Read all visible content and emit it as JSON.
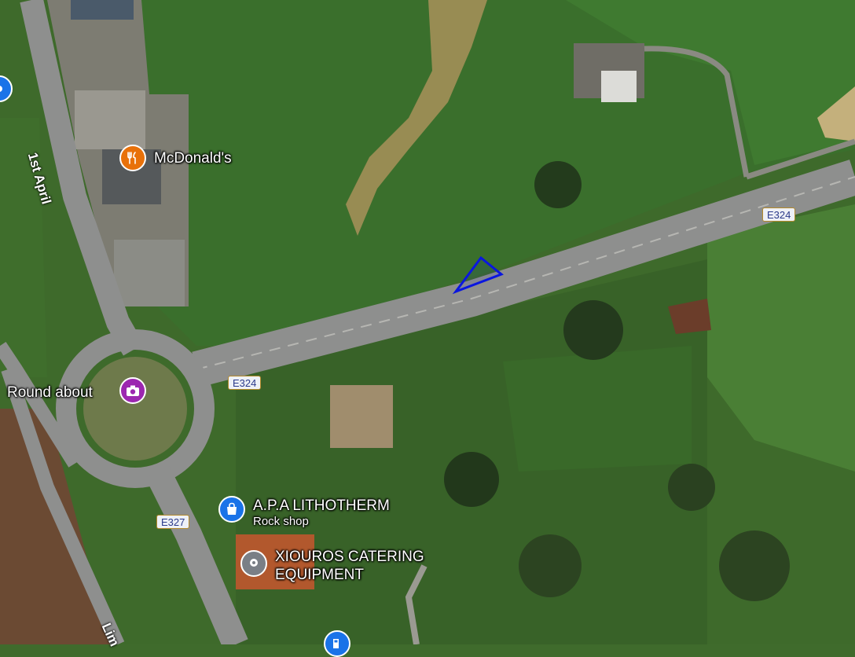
{
  "map": {
    "type": "satellite",
    "places": {
      "mcdonalds": {
        "name": "McDonald's",
        "icon": "restaurant-icon",
        "color": "#e8710a"
      },
      "roundabout": {
        "name": "Round about",
        "icon": "camera-icon",
        "color": "#9c27b0"
      },
      "lithotherm": {
        "name": "A.P.A LITHOTHERM",
        "subtitle": "Rock shop",
        "icon": "shopping-bag-icon",
        "color": "#1a73e8"
      },
      "xiouros": {
        "line1": "XIOUROS CATERING",
        "line2": "EQUIPMENT",
        "icon": "location-pin-icon",
        "color": "#7a7f86"
      },
      "partial_pin": {
        "icon": "fuel-icon",
        "color": "#1a73e8"
      },
      "partial_left_pin": {
        "icon": "location-pin-icon",
        "color": "#1a73e8"
      }
    },
    "roads": {
      "first_april": "1st April",
      "lim": "Lim",
      "shields": [
        "E324",
        "E324",
        "E327"
      ]
    },
    "drawn_triangle_color": "#0a16e0"
  }
}
